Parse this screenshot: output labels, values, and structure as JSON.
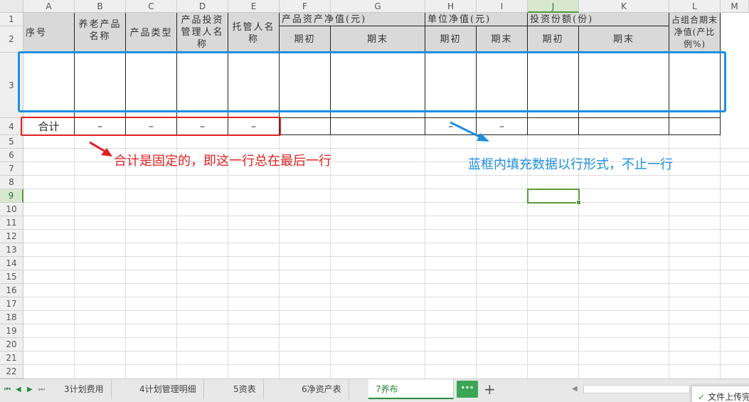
{
  "columns": [
    "A",
    "B",
    "C",
    "D",
    "E",
    "F",
    "G",
    "H",
    "I",
    "J",
    "K",
    "L",
    "M"
  ],
  "rows": [
    "1",
    "2",
    "3",
    "4",
    "5",
    "6",
    "7",
    "8",
    "9",
    "10",
    "11",
    "12",
    "13",
    "14",
    "15",
    "16",
    "17",
    "18",
    "19",
    "20",
    "21",
    "22"
  ],
  "header": {
    "seq": "序号",
    "b": "养老产品名称",
    "c": "产品类型",
    "d": "产品投资管理人名称",
    "e": "托管人名称",
    "fg_group": "产品资产净值(元)",
    "f_sub": "期初",
    "g_sub": "期末",
    "hi_group": "单位净值(元)",
    "h_sub": "期初",
    "i_sub": "期末",
    "jk_group": "投资份额(份)",
    "j_sub": "期初",
    "k_sub": "期末",
    "l": "占组合期末净值(产比例%)"
  },
  "total_row": {
    "label": "合计",
    "dash": "–"
  },
  "annotations": {
    "red_text": "合计是固定的，即这一行总在最后一行",
    "blue_text": "蓝框内填充数据以行形式，不止一行"
  },
  "tabs": [
    {
      "label": "3计划费用"
    },
    {
      "label": "4计划管理明细"
    },
    {
      "label": "5资表"
    },
    {
      "label": "6净资产表"
    },
    {
      "label": "7养布",
      "active": true
    }
  ],
  "tab_more_label": "···",
  "tab_add_label": "+",
  "toast_text": "文件上传完",
  "colors": {
    "accent_green": "#2a8a3a",
    "annot_red": "#e02020",
    "annot_blue": "#1e8fe0"
  }
}
